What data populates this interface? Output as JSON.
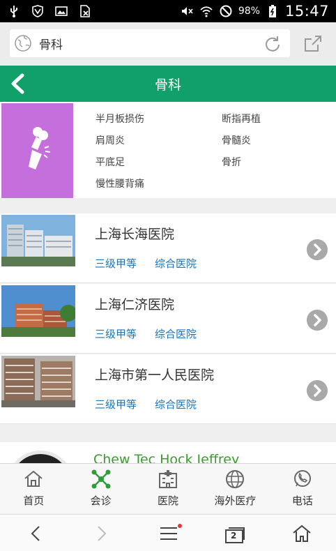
{
  "status_bar": {
    "battery_percent": "98%",
    "time": "15:47",
    "left_icons": [
      "usb-icon",
      "vpn-shield-icon",
      "image-icon",
      "file-x-icon"
    ],
    "right_icons": [
      "mute-icon",
      "wifi-icon",
      "block-icon",
      "battery-charging-icon"
    ]
  },
  "browser": {
    "url_text": "骨科"
  },
  "header": {
    "title": "骨科"
  },
  "category": {
    "items": [
      "半月板损伤",
      "断指再植",
      "肩周炎",
      "骨髓炎",
      "平底足",
      "骨折",
      "慢性腰背痛"
    ],
    "tile_color": "#c46fdc"
  },
  "hospitals": [
    {
      "name": "上海长海医院",
      "level": "三级甲等",
      "type": "综合医院"
    },
    {
      "name": "上海仁济医院",
      "level": "三级甲等",
      "type": "综合医院"
    },
    {
      "name": "上海市第一人民医院",
      "level": "三级甲等",
      "type": "综合医院"
    }
  ],
  "doctor": {
    "name": "Chew Tec Hock  Jeffrey"
  },
  "tabs": [
    {
      "label": "首页",
      "icon": "home-icon"
    },
    {
      "label": "会诊",
      "icon": "network-icon"
    },
    {
      "label": "医院",
      "icon": "hospital-icon"
    },
    {
      "label": "海外医疗",
      "icon": "globe-icon"
    },
    {
      "label": "电话",
      "icon": "phone-icon"
    }
  ],
  "nav": {
    "tab_count": "2"
  },
  "colors": {
    "header_green": "#12a06a",
    "link_blue": "#1a74b8",
    "doctor_green": "#3a9c2e"
  }
}
